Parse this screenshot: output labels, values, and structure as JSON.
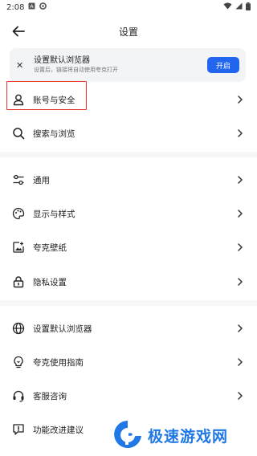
{
  "status_bar": {
    "time": "2:08"
  },
  "header": {
    "title": "设置"
  },
  "banner": {
    "title": "设置默认浏览器",
    "subtitle": "设置后，链接将自动使用夸克打开",
    "button_label": "开启"
  },
  "settings": {
    "items": [
      {
        "label": "账号与安全",
        "icon": "user-icon"
      },
      {
        "label": "搜索与浏览",
        "icon": "search-icon"
      },
      {
        "label": "通用",
        "icon": "sliders-icon"
      },
      {
        "label": "显示与样式",
        "icon": "palette-icon"
      },
      {
        "label": "夸克壁纸",
        "icon": "wallpaper-icon"
      },
      {
        "label": "隐私设置",
        "icon": "lock-icon"
      },
      {
        "label": "设置默认浏览器",
        "icon": "globe-icon"
      },
      {
        "label": "夸克使用指南",
        "icon": "lightbulb-icon"
      },
      {
        "label": "客服咨询",
        "icon": "headset-icon"
      },
      {
        "label": "功能改进建议",
        "icon": "feedback-icon"
      }
    ]
  },
  "watermark": {
    "text": "极速游戏网"
  },
  "colors": {
    "accent": "#2266f0",
    "highlight": "#e23a2f",
    "watermark": "#1f78e6"
  }
}
